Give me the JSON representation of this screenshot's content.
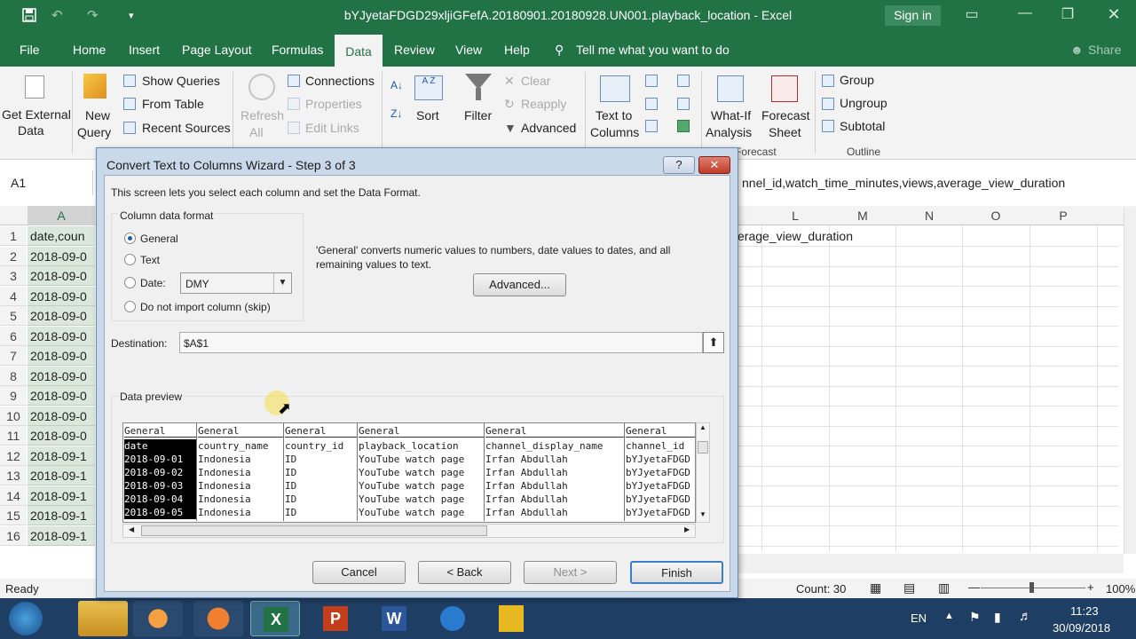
{
  "window": {
    "title": "bYJyetaFDGD29xljiGFefA.20180901.20180928.UN001.playback_location  -  Excel",
    "sign_in": "Sign in",
    "share": "Share"
  },
  "tabs": [
    "File",
    "Home",
    "Insert",
    "Page Layout",
    "Formulas",
    "Data",
    "Review",
    "View",
    "Help"
  ],
  "active_tab": "Data",
  "tell_me": "Tell me what you want to do",
  "ribbon": {
    "get_external_data": [
      "Get External",
      "Data"
    ],
    "new_query": [
      "New",
      "Query"
    ],
    "show_queries": "Show Queries",
    "from_table": "From Table",
    "recent_sources": "Recent Sources",
    "refresh_all": [
      "Refresh",
      "All"
    ],
    "connections": "Connections",
    "properties": "Properties",
    "edit_links": "Edit Links",
    "sort": "Sort",
    "filter": "Filter",
    "clear": "Clear",
    "reapply": "Reapply",
    "advanced": "Advanced",
    "text_to_columns": [
      "Text to",
      "Columns"
    ],
    "what_if": [
      "What-If",
      "Analysis"
    ],
    "forecast_sheet": [
      "Forecast",
      "Sheet"
    ],
    "group": "Group",
    "ungroup": "Ungroup",
    "subtotal": "Subtotal",
    "forecast_label": "Forecast",
    "outline_label": "Outline"
  },
  "formula_bar": {
    "name_box": "A1",
    "content": "nnel_id,watch_time_minutes,views,average_view_duration"
  },
  "grid": {
    "col_A": "A",
    "right_cols": [
      "L",
      "M",
      "N",
      "O",
      "P"
    ],
    "rows": [
      "1",
      "2",
      "3",
      "4",
      "5",
      "6",
      "7",
      "8",
      "9",
      "10",
      "11",
      "12",
      "13",
      "14",
      "15",
      "16"
    ],
    "colA_values": [
      "date,coun",
      "2018-09-0",
      "2018-09-0",
      "2018-09-0",
      "2018-09-0",
      "2018-09-0",
      "2018-09-0",
      "2018-09-0",
      "2018-09-0",
      "2018-09-0",
      "2018-09-0",
      "2018-09-1",
      "2018-09-1",
      "2018-09-1",
      "2018-09-1",
      "2018-09-1"
    ],
    "row1_right": "erage_view_duration"
  },
  "status": {
    "ready": "Ready",
    "count": "Count: 30",
    "zoom": "100%"
  },
  "taskbar": {
    "lang": "EN",
    "time": "11:23",
    "date": "30/09/2018"
  },
  "dialog": {
    "title": "Convert Text to Columns Wizard - Step 3 of 3",
    "help": "?",
    "intro": "This screen lets you select each column and set the Data Format.",
    "format_group": "Column data format",
    "opt_general": "General",
    "opt_text": "Text",
    "opt_date": "Date:",
    "date_format": "DMY",
    "opt_skip": "Do not import column (skip)",
    "selected": "General",
    "description": "'General' converts numeric values to numbers, date values to dates, and all remaining values to text.",
    "advanced_btn": "Advanced...",
    "destination_label": "Destination:",
    "destination_value": "$A$1",
    "preview_label": "Data preview",
    "preview": {
      "headers": [
        "General",
        "General",
        "General",
        "General",
        "General",
        "General"
      ],
      "columns": [
        [
          "date",
          "2018-09-01",
          "2018-09-02",
          "2018-09-03",
          "2018-09-04",
          "2018-09-05"
        ],
        [
          "country_name",
          "Indonesia",
          "Indonesia",
          "Indonesia",
          "Indonesia",
          "Indonesia"
        ],
        [
          "country_id",
          "ID",
          "ID",
          "ID",
          "ID",
          "ID"
        ],
        [
          "playback_location",
          "YouTube watch page",
          "YouTube watch page",
          "YouTube watch page",
          "YouTube watch page",
          "YouTube watch page"
        ],
        [
          "channel_display_name",
          "Irfan Abdullah",
          "Irfan Abdullah",
          "Irfan Abdullah",
          "Irfan Abdullah",
          "Irfan Abdullah"
        ],
        [
          "channel_id",
          "bYJyetaFDGD",
          "bYJyetaFDGD",
          "bYJyetaFDGD",
          "bYJyetaFDGD",
          "bYJyetaFDGD"
        ]
      ]
    },
    "cancel": "Cancel",
    "back": "< Back",
    "next": "Next >",
    "finish": "Finish"
  },
  "colors": {
    "excel_green": "#217346",
    "selection": "#d9e8da",
    "taskbar": "#1f3e63"
  }
}
